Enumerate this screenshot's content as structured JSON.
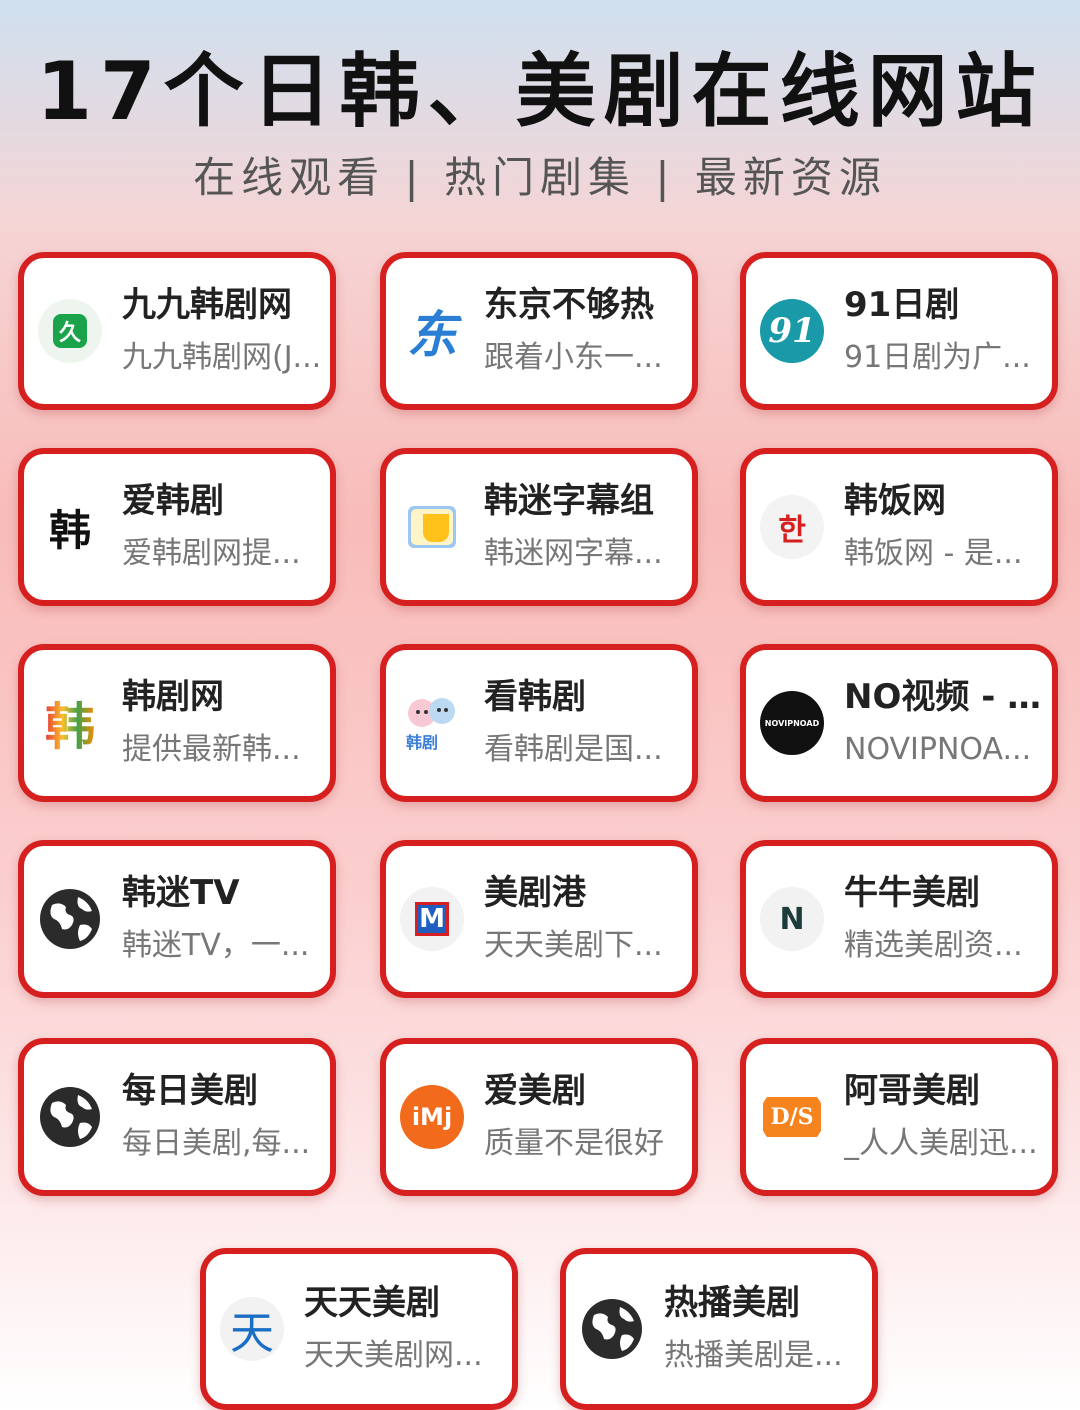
{
  "header": {
    "title": "17个日韩、美剧在线网站",
    "subtitle": "在线观看 | 热门剧集 | 最新资源"
  },
  "sites": [
    {
      "name": "九九韩剧网",
      "desc": "九九韩剧网(J...",
      "icon": "jiu-logo-icon"
    },
    {
      "name": "东京不够热",
      "desc": "跟着小东一...",
      "icon": "dong-logo-icon"
    },
    {
      "name": "91日剧",
      "desc": "91日剧为广...",
      "icon": "91-logo-icon"
    },
    {
      "name": "爱韩剧",
      "desc": "爱韩剧网提...",
      "icon": "han-logo-icon"
    },
    {
      "name": "韩迷字幕组",
      "desc": "韩迷网字幕...",
      "icon": "folder-logo-icon"
    },
    {
      "name": "韩饭网",
      "desc": "韩饭网 - 是...",
      "icon": "hangul-logo-icon"
    },
    {
      "name": "韩剧网",
      "desc": "提供最新韩...",
      "icon": "colorful-han-logo-icon"
    },
    {
      "name": "看韩剧",
      "desc": "看韩剧是国...",
      "icon": "cartoon-logo-icon"
    },
    {
      "name": "NO视频 - ...",
      "desc": "NOVIPNOA...",
      "icon": "novipnoad-logo-icon"
    },
    {
      "name": "韩迷TV",
      "desc": "韩迷TV，一...",
      "icon": "globe-icon"
    },
    {
      "name": "美剧港",
      "desc": "天天美剧下...",
      "icon": "m-logo-icon"
    },
    {
      "name": "牛牛美剧",
      "desc": "精选美剧资...",
      "icon": "n-logo-icon"
    },
    {
      "name": "每日美剧",
      "desc": "每日美剧,每...",
      "icon": "globe-icon"
    },
    {
      "name": "爱美剧",
      "desc": "质量不是很好",
      "icon": "imj-logo-icon"
    },
    {
      "name": "阿哥美剧",
      "desc": "_人人美剧迅...",
      "icon": "ds-logo-icon"
    },
    {
      "name": "天天美剧",
      "desc": "天天美剧网...",
      "icon": "tian-logo-icon"
    },
    {
      "name": "热播美剧",
      "desc": "热播美剧是...",
      "icon": "globe-icon"
    }
  ],
  "logo_text": {
    "jiu": "久",
    "dong": "东",
    "ninety_one": "91",
    "han": "韩",
    "hangul": "한",
    "colorful_han": "韩",
    "cartoon": "韩剧",
    "novipnoad": "NOVIPNOAD",
    "m": "M",
    "n": "N",
    "imj": "iMj",
    "ds": "D/S",
    "tian": "天"
  },
  "colors": {
    "card_border": "#d61f1f",
    "title": "#111111",
    "subtitle": "#555555",
    "jiu_green": "#1aa34a",
    "dong_blue": "#2a7fd4",
    "teal_91": "#1a9aa8",
    "imj_orange": "#f26a1b",
    "ds_orange": "#f5841f"
  }
}
